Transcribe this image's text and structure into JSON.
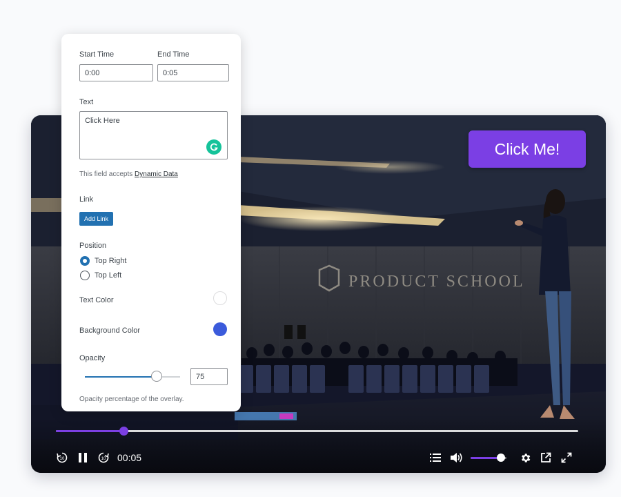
{
  "panel": {
    "start_time": {
      "label": "Start Time",
      "value": "0:00"
    },
    "end_time": {
      "label": "End Time",
      "value": "0:05"
    },
    "text": {
      "label": "Text",
      "value": "Click Here",
      "icon": "grammarly-icon"
    },
    "dynamic_hint": {
      "prefix": "This field accepts ",
      "link": "Dynamic Data"
    },
    "link": {
      "label": "Link",
      "button": "Add Link"
    },
    "position": {
      "label": "Position",
      "options": [
        {
          "label": "Top Right",
          "checked": true
        },
        {
          "label": "Top Left",
          "checked": false
        }
      ]
    },
    "text_color": {
      "label": "Text Color",
      "color": "#ffffff"
    },
    "background_color": {
      "label": "Background Color",
      "color": "#3b5bdb"
    },
    "opacity": {
      "label": "Opacity",
      "value": "75",
      "percent": 75,
      "hint": "Opacity percentage of the overlay."
    }
  },
  "player": {
    "overlay_button": "Click Me!",
    "background_sign": "PRODUCT SCHOOL",
    "current_time": "00:05",
    "progress_fraction": 0.13,
    "volume_fraction": 0.85,
    "accent_color": "#7b3fe4",
    "icons": [
      "rewind-10-icon",
      "pause-icon",
      "forward-10-icon",
      "chapters-icon",
      "volume-icon",
      "settings-icon",
      "share-icon",
      "fullscreen-icon"
    ]
  }
}
